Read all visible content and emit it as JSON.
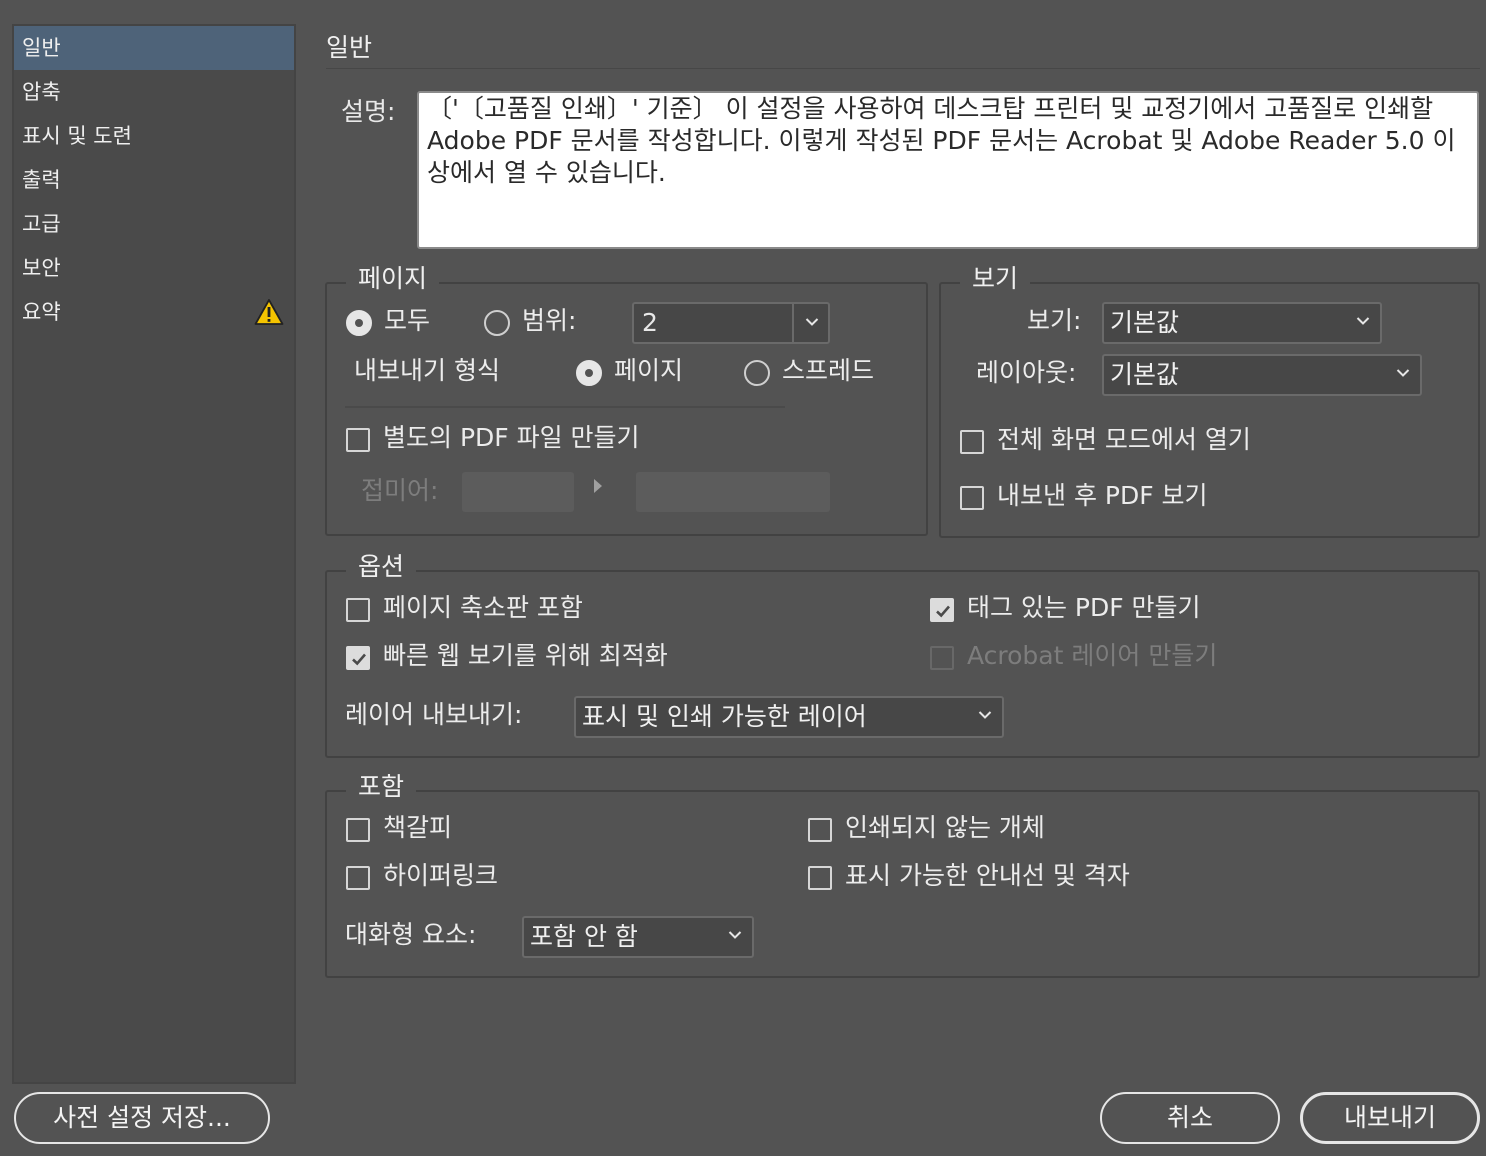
{
  "sidebar": {
    "items": [
      {
        "label": "일반"
      },
      {
        "label": "압축"
      },
      {
        "label": "표시 및 도련"
      },
      {
        "label": "출력"
      },
      {
        "label": "고급"
      },
      {
        "label": "보안"
      },
      {
        "label": "요약"
      }
    ]
  },
  "page_title": "일반",
  "description": {
    "label": "설명:",
    "text": "〔'〔고품질 인쇄〕' 기준〕 이 설정을 사용하여 데스크탑 프린터 및 교정기에서 고품질로 인쇄할 Adobe PDF 문서를 작성합니다. 이렇게 작성된 PDF 문서는 Acrobat 및 Adobe Reader 5.0 이상에서 열 수 있습니다."
  },
  "pages": {
    "title": "페이지",
    "all_label": "모두",
    "range_label": "범위:",
    "range_value": "2",
    "export_as_label": "내보내기 형식",
    "export_pages_label": "페이지",
    "export_spreads_label": "스프레드",
    "separate_pdf_label": "별도의 PDF 파일 만들기",
    "suffix_label": "접미어:"
  },
  "viewing": {
    "title": "보기",
    "view_label": "보기:",
    "view_value": "기본값",
    "layout_label": "레이아웃:",
    "layout_value": "기본값",
    "fullscreen_label": "전체 화면 모드에서 열기",
    "view_after_label": "내보낸 후 PDF 보기"
  },
  "options": {
    "title": "옵션",
    "thumbnails_label": "페이지 축소판 포함",
    "fast_web_label": "빠른 웹 보기를 위해 최적화",
    "tagged_pdf_label": "태그 있는 PDF 만들기",
    "acrobat_layers_label": "Acrobat 레이어 만들기",
    "export_layers_label": "레이어 내보내기:",
    "export_layers_value": "표시 및 인쇄 가능한 레이어"
  },
  "include": {
    "title": "포함",
    "bookmarks_label": "책갈피",
    "hyperlinks_label": "하이퍼링크",
    "non_printing_label": "인쇄되지 않는 개체",
    "guides_label": "표시 가능한 안내선 및 격자",
    "interactive_label": "대화형 요소:",
    "interactive_value": "포함 안 함"
  },
  "buttons": {
    "save_preset": "사전 설정 저장...",
    "cancel": "취소",
    "export": "내보내기"
  },
  "state": {
    "selected_sidebar": "일반",
    "pages_mode": "모두",
    "export_as": "페이지",
    "separate_pdf": false,
    "fullscreen": false,
    "view_after": false,
    "thumbnails": false,
    "fast_web": true,
    "tagged_pdf": true,
    "acrobat_layers": false,
    "bookmarks": false,
    "hyperlinks": false,
    "non_printing": false,
    "guides": false
  },
  "colors": {
    "background": "#535353",
    "sidebar_selected": "#4e6379",
    "warning": "#f5c400"
  },
  "icons": {
    "summary_warning": "warning-triangle-icon"
  }
}
